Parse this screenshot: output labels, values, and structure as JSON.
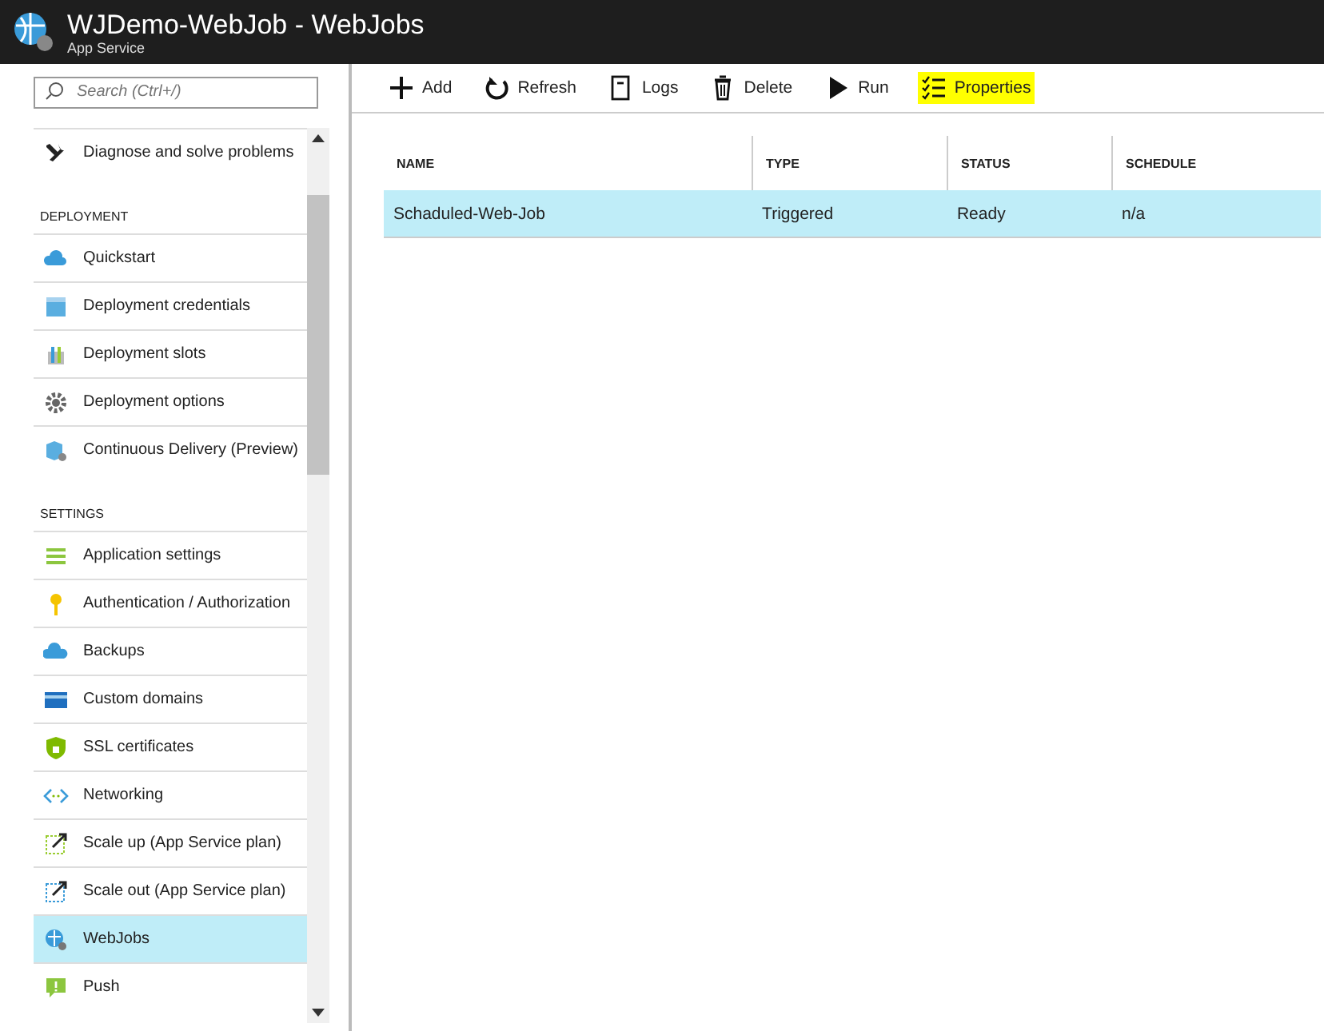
{
  "header": {
    "title": "WJDemo-WebJob - WebJobs",
    "subtitle": "App Service"
  },
  "search": {
    "placeholder": "Search (Ctrl+/)"
  },
  "sidebar": {
    "sections": [
      {
        "items": [
          {
            "label": "Diagnose and solve problems",
            "selected": false
          }
        ]
      },
      {
        "heading": "DEPLOYMENT",
        "items": [
          {
            "label": "Quickstart",
            "selected": false
          },
          {
            "label": "Deployment credentials",
            "selected": false
          },
          {
            "label": "Deployment slots",
            "selected": false
          },
          {
            "label": "Deployment options",
            "selected": false
          },
          {
            "label": "Continuous Delivery (Preview)",
            "selected": false
          }
        ]
      },
      {
        "heading": "SETTINGS",
        "items": [
          {
            "label": "Application settings",
            "selected": false
          },
          {
            "label": "Authentication / Authorization",
            "selected": false
          },
          {
            "label": "Backups",
            "selected": false
          },
          {
            "label": "Custom domains",
            "selected": false
          },
          {
            "label": "SSL certificates",
            "selected": false
          },
          {
            "label": "Networking",
            "selected": false
          },
          {
            "label": "Scale up (App Service plan)",
            "selected": false
          },
          {
            "label": "Scale out (App Service plan)",
            "selected": false
          },
          {
            "label": "WebJobs",
            "selected": true
          },
          {
            "label": "Push",
            "selected": false
          }
        ]
      }
    ]
  },
  "toolbar": [
    {
      "label": "Add",
      "highlighted": false
    },
    {
      "label": "Refresh",
      "highlighted": false
    },
    {
      "label": "Logs",
      "highlighted": false
    },
    {
      "label": "Delete",
      "highlighted": false
    },
    {
      "label": "Run",
      "highlighted": false
    },
    {
      "label": "Properties",
      "highlighted": true
    }
  ],
  "table": {
    "columns": [
      "NAME",
      "TYPE",
      "STATUS",
      "SCHEDULE"
    ],
    "rows": [
      {
        "cells": [
          "Schaduled-Web-Job",
          "Triggered",
          "Ready",
          "n/a"
        ],
        "selected": true
      }
    ]
  }
}
